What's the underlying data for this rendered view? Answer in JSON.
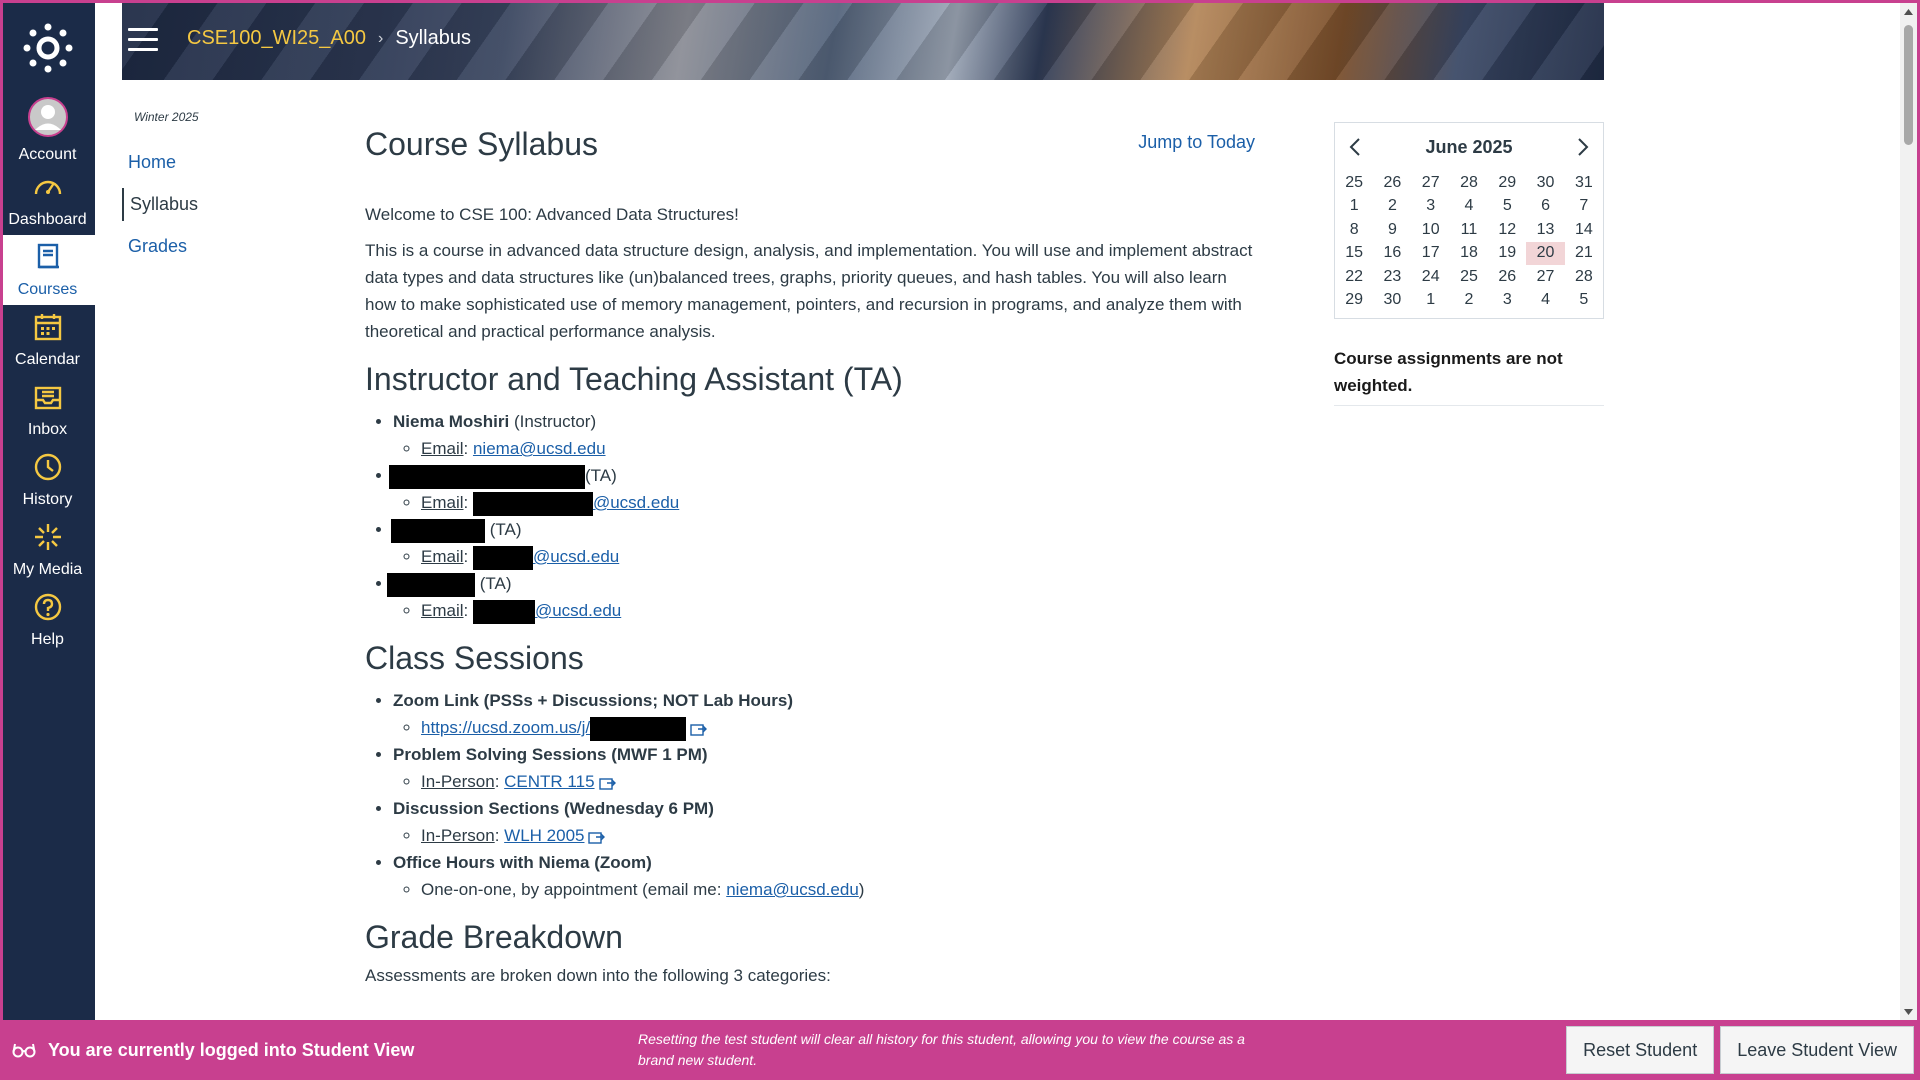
{
  "nav": {
    "items": [
      {
        "id": "account",
        "label": "Account",
        "icon": "account-avatar-icon"
      },
      {
        "id": "dashboard",
        "label": "Dashboard",
        "icon": "dashboard-gauge-icon"
      },
      {
        "id": "courses",
        "label": "Courses",
        "icon": "courses-book-icon",
        "active": true
      },
      {
        "id": "calendar",
        "label": "Calendar",
        "icon": "calendar-icon"
      },
      {
        "id": "inbox",
        "label": "Inbox",
        "icon": "inbox-icon"
      },
      {
        "id": "history",
        "label": "History",
        "icon": "clock-icon"
      },
      {
        "id": "mymedia",
        "label": "My Media",
        "icon": "sparkle-icon"
      },
      {
        "id": "help",
        "label": "Help",
        "icon": "help-icon"
      }
    ]
  },
  "header": {
    "course": "CSE100_WI25_A00",
    "current_page": "Syllabus"
  },
  "course_nav": {
    "term": "Winter 2025",
    "items": [
      {
        "label": "Home"
      },
      {
        "label": "Syllabus",
        "active": true
      },
      {
        "label": "Grades"
      }
    ]
  },
  "main": {
    "title": "Course Syllabus",
    "jump_to_today": "Jump to Today",
    "welcome": "Welcome to CSE 100: Advanced Data Structures!",
    "description": "This is a course in advanced data structure design, analysis, and implementation. You will use and implement abstract data types and data structures like (un)balanced trees, graphs, priority queues, and hash tables. You will also learn how to make sophisticated use of memory management, pointers, and recursion in programs, and analyze them with theoretical and practical performance analysis.",
    "instructors_heading": "Instructor and Teaching Assistant (TA)",
    "instructor": {
      "name": "Niema Moshiri",
      "role": "(Instructor)",
      "email_label": "Email",
      "email": "niema@ucsd.edu"
    },
    "tas": [
      {
        "role": "(TA)",
        "email_label": "Email",
        "email_domain": "@ucsd.edu"
      },
      {
        "role": "(TA)",
        "email_label": "Email",
        "email_domain": "@ucsd.edu"
      },
      {
        "role": "(TA)",
        "email_label": "Email",
        "email_domain": "@ucsd.edu"
      }
    ],
    "sessions_heading": "Class Sessions",
    "sessions": {
      "zoom_title": "Zoom Link (PSSs + Discussions; NOT Lab Hours)",
      "zoom_link": "https://ucsd.zoom.us/j/",
      "pss_title": "Problem Solving Sessions (MWF 1 PM)",
      "pss_label": "In-Person",
      "pss_location": "CENTR 115",
      "discussion_title": "Discussion Sections (Wednesday 6 PM)",
      "discussion_label": "In-Person",
      "discussion_location": "WLH 2005",
      "office_title": "Office Hours with Niema (Zoom)",
      "office_text": "One-on-one, by appointment (email me: ",
      "office_email": "niema@ucsd.edu",
      "office_close": ")"
    },
    "grade_heading": "Grade Breakdown",
    "grade_text": "Assessments are broken down into the following 3 categories:"
  },
  "calendar": {
    "month": "June 2025",
    "weeks": [
      [
        "25",
        "26",
        "27",
        "28",
        "29",
        "30",
        "31"
      ],
      [
        "1",
        "2",
        "3",
        "4",
        "5",
        "6",
        "7"
      ],
      [
        "8",
        "9",
        "10",
        "11",
        "12",
        "13",
        "14"
      ],
      [
        "15",
        "16",
        "17",
        "18",
        "19",
        "20",
        "21"
      ],
      [
        "22",
        "23",
        "24",
        "25",
        "26",
        "27",
        "28"
      ],
      [
        "29",
        "30",
        "1",
        "2",
        "3",
        "4",
        "5"
      ]
    ],
    "today": "20"
  },
  "sidebar_note": "Course assignments are not weighted.",
  "student_view": {
    "message": "You are currently logged into Student View",
    "note": "Resetting the test student will clear all history for this student, allowing you to view the course as a brand new student.",
    "reset_label": "Reset Student",
    "leave_label": "Leave Student View"
  },
  "colors": {
    "nav_bg": "#1b2b48",
    "accent": "#c8408f",
    "link": "#1b5fa8",
    "course_crumb": "#f5c842"
  }
}
